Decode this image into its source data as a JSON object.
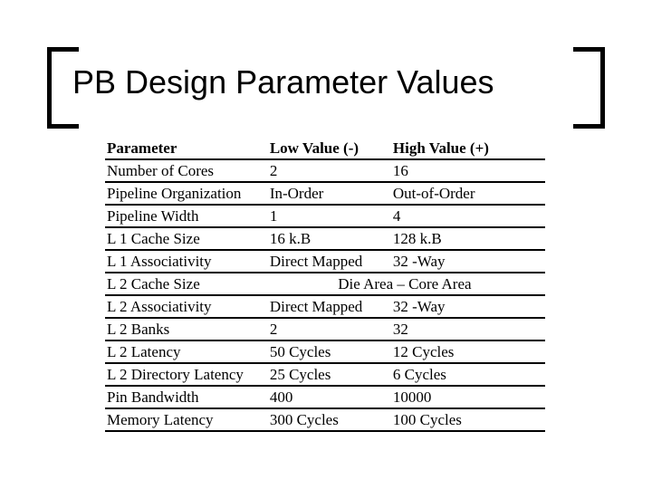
{
  "title": "PB Design Parameter Values",
  "table": {
    "headers": [
      "Parameter",
      "Low Value (-)",
      "High Value (+)"
    ],
    "rows": [
      {
        "p": "Number of Cores",
        "lo": "2",
        "hi": "16"
      },
      {
        "p": "Pipeline Organization",
        "lo": "In-Order",
        "hi": "Out-of-Order"
      },
      {
        "p": "Pipeline Width",
        "lo": "1",
        "hi": "4"
      },
      {
        "p": "L 1 Cache Size",
        "lo": "16 k.B",
        "hi": "128 k.B"
      },
      {
        "p": "L 1 Associativity",
        "lo": "Direct Mapped",
        "hi": "32 -Way"
      },
      {
        "p": "L 2 Cache Size",
        "span": "Die Area – Core Area"
      },
      {
        "p": "L 2 Associativity",
        "lo": "Direct Mapped",
        "hi": "32 -Way"
      },
      {
        "p": "L 2 Banks",
        "lo": "2",
        "hi": "32"
      },
      {
        "p": "L 2 Latency",
        "lo": "50 Cycles",
        "hi": "12 Cycles"
      },
      {
        "p": "L 2 Directory Latency",
        "lo": "25 Cycles",
        "hi": "6 Cycles"
      },
      {
        "p": "Pin Bandwidth",
        "lo": "400",
        "hi": "10000"
      },
      {
        "p": "Memory Latency",
        "lo": "300 Cycles",
        "hi": "100 Cycles"
      }
    ]
  },
  "chart_data": {
    "type": "table",
    "title": "PB Design Parameter Values",
    "columns": [
      "Parameter",
      "Low Value (-)",
      "High Value (+)"
    ],
    "rows": [
      [
        "Number of Cores",
        "2",
        "16"
      ],
      [
        "Pipeline Organization",
        "In-Order",
        "Out-of-Order"
      ],
      [
        "Pipeline Width",
        "1",
        "4"
      ],
      [
        "L 1 Cache Size",
        "16 k.B",
        "128 k.B"
      ],
      [
        "L 1 Associativity",
        "Direct Mapped",
        "32 -Way"
      ],
      [
        "L 2 Cache Size",
        "Die Area – Core Area",
        "Die Area – Core Area"
      ],
      [
        "L 2 Associativity",
        "Direct Mapped",
        "32 -Way"
      ],
      [
        "L 2 Banks",
        "2",
        "32"
      ],
      [
        "L 2 Latency",
        "50 Cycles",
        "12 Cycles"
      ],
      [
        "L 2 Directory Latency",
        "25 Cycles",
        "6 Cycles"
      ],
      [
        "Pin Bandwidth",
        "400",
        "10000"
      ],
      [
        "Memory Latency",
        "300 Cycles",
        "100 Cycles"
      ]
    ]
  }
}
